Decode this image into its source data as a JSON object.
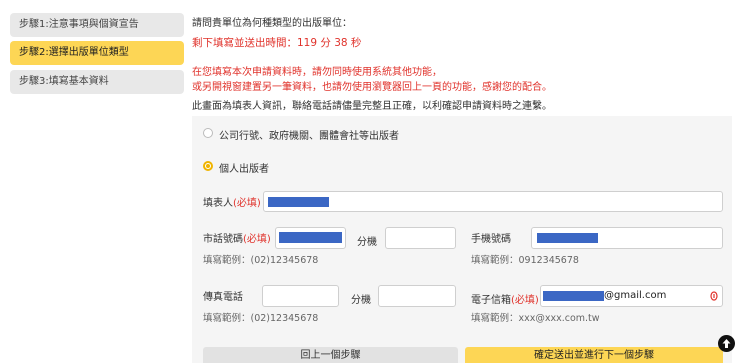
{
  "steps": [
    {
      "label": "步驟1:注意事項與個資宣告",
      "active": false
    },
    {
      "label": "步驟2:選擇出版單位類型",
      "active": true
    },
    {
      "label": "步驟3:填寫基本資料",
      "active": false
    }
  ],
  "header": {
    "question": "請問貴單位為何種類型的出版單位：",
    "countdown": "剩下填寫並送出時間：119 分 38 秒",
    "warning_line1": "在您填寫本次申請資料時，請勿同時使用系統其他功能，",
    "warning_line2": "或另開視窗建置另一筆資料，也請勿使用瀏覽器回上一頁的功能，感謝您的配合。",
    "notice": "此畫面為填表人資訊，聯絡電話請儘量完整且正確，以利確認申請資料時之連繫。"
  },
  "form": {
    "option_org": "公司行號、政府機關、團體會社等出版者",
    "option_person": "個人出版者",
    "selected_option": "個人出版者",
    "filler_label": "填表人",
    "required_mark": "(必填)",
    "phone_label": "市話號碼",
    "ext_label": "分機",
    "phone_hint": "填寫範例：(02)12345678",
    "mobile_label": "手機號碼",
    "mobile_hint": "填寫範例：0912345678",
    "fax_label": "傳真電話",
    "fax_hint": "填寫範例：(02)12345678",
    "email_label": "電子信箱",
    "email_value": "@gmail.com",
    "email_hint": "填寫範例：xxx@xxx.com.tw"
  },
  "buttons": {
    "prev": "回上一個步驟",
    "next": "確定送出並進行下一個步驟"
  },
  "colors": {
    "accent": "#fdd655",
    "required": "#e0322b",
    "redaction": "#3b67c4"
  },
  "icons": {
    "back_to_top": "arrow-up-icon",
    "email_validate": "eye-icon"
  }
}
